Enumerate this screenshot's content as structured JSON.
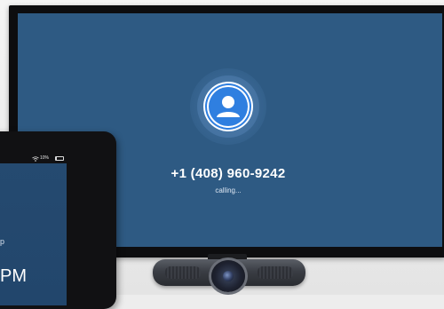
{
  "call": {
    "phone_number": "+1 (408) 960-9242",
    "status": "calling..."
  },
  "tablet": {
    "battery_text": "10%",
    "text_fragment_1": "p",
    "text_fragment_2": "PM"
  },
  "colors": {
    "tv_screen": "#2e5a83",
    "avatar_accent": "#2f7fe0"
  },
  "icons": {
    "avatar": "person-avatar-icon",
    "wifi": "wifi-icon",
    "battery": "battery-icon"
  }
}
